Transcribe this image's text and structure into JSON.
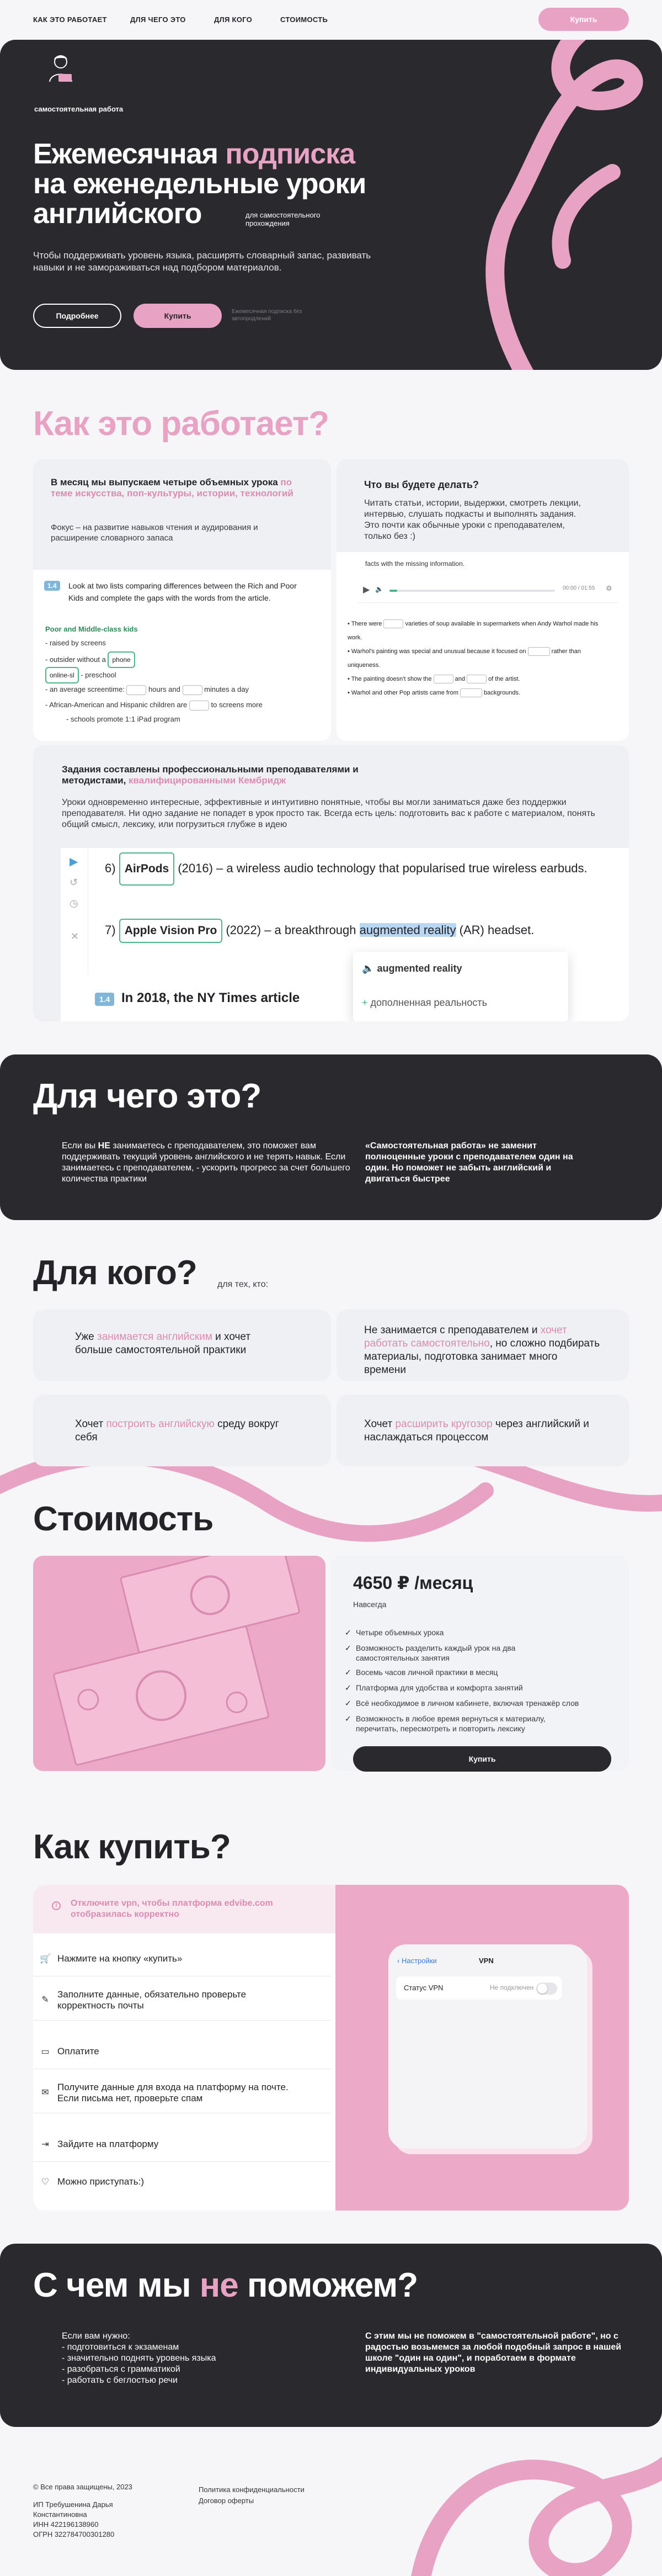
{
  "nav": {
    "links": [
      "КАК ЭТО РАБОТАЕТ",
      "ДЛЯ ЧЕГО ЭТО",
      "ДЛЯ КОГО",
      "СТОИМОСТЬ"
    ],
    "buy": "Купить"
  },
  "hero": {
    "brand": "самостоятельная работа",
    "title_a": "Ежемесячная ",
    "title_pink": "подписка",
    "title_b": "на еженедельные уроки",
    "title_c": "английского",
    "side": "для самостоятельного прохождения",
    "desc": "Чтобы поддерживать уровень языка, расширять словарный запас, развивать навыки и не замораживаться над подбором материалов.",
    "btn_more": "Подробнее",
    "btn_buy": "Купить",
    "note": "Ежемесячная подписка без автопродлений"
  },
  "how": {
    "title": "Как это работает?",
    "c1": {
      "title_a": "В месяц мы выпускаем четыре объемных урока ",
      "title_pink": "по теме искусства, поп-культуры, истории, технологий",
      "sub": "Фокус – на развитие навыков чтения и аудирования и расширение словарного запаса",
      "task_no": "1.4",
      "task": "Look at two lists comparing differences between the Rich and Poor Kids and complete the gaps with the words from the article.",
      "list_title": "Poor and Middle-class kids",
      "items": [
        "- raised by screens",
        "- outsider without a",
        "- preschool",
        "- an average screentime:",
        "hours and",
        "minutes a day",
        "- African-American and Hispanic children are",
        "to screens more",
        "- schools promote 1:1 iPad program"
      ],
      "chip1": "phone",
      "chip2": "online-sl"
    },
    "c2": {
      "title": "Что вы будете делать?",
      "text": "Читать статьи, истории, выдержки, смотреть лекции, интервью, слушать подкасты и выполнять задания. Это почти как обычные уроки с преподавателем, только без :)",
      "facts": "facts with the missing information.",
      "time": "00:00 / 01:55",
      "b1": "• There were",
      "b1b": "varieties of soup available in supermarkets when Andy Warhol made his work.",
      "b2": "• Warhol's painting was special and unusual because it focused on",
      "b2b": "rather than uniqueness.",
      "b3": "• The painting doesn't show the",
      "b3b": "and",
      "b3c": "of the artist.",
      "b4": "• Warhol and other Pop artists came from",
      "b4b": "backgrounds."
    },
    "c3": {
      "title_a": "Задания составлены профессиональными преподавателями и методистами, ",
      "title_pink": "квалифицированными Кембридж",
      "text": "Уроки одновременно интересные, эффективные и интуитивно понятные, чтобы вы могли заниматься даже без поддержки преподавателя. Ни одно задание не попадет в урок просто так. Всегда есть цель: подготовить вас к работе с материалом, понять общий смысл, лексику, или погрузиться глубже в идею",
      "l1n": "6)",
      "l1chip": "AirPods",
      "l1": "(2016) – a wireless audio technology that popularised true wireless earbuds.",
      "l2n": "7)",
      "l2chip": "Apple Vision Pro",
      "l2a": "(2022) – a breakthrough ",
      "l2hl": "augmented reality",
      "l2b": " (AR) headset.",
      "pop1": "augmented reality",
      "pop2": "дополненная реальность",
      "t3no": "1.4",
      "t3": "In 2018, the NY Times article"
    }
  },
  "why": {
    "title": "Для чего это?",
    "left_a": "Если вы ",
    "left_b": "НЕ",
    "left_c": " занимаетесь с преподавателем, это поможет вам поддерживать текущий уровень английского и не терять навык. Если занимаетесь с преподавателем, - ускорить прогресс за счет большего количества практики",
    "right": "«Самостоятельная работа» не заменит полноценные уроки с преподавателем один на один. Но поможет не забыть английский и двигаться быстрее"
  },
  "who": {
    "title": "Для кого?",
    "sub": "для тех, кто:",
    "c1a": "Уже ",
    "c1p": "занимается английским",
    "c1b": " и хочет больше самостоятельной практики",
    "c2a": "Не занимается с преподавателем и ",
    "c2p": "хочет работать самостоятельно",
    "c2b": ", но сложно подбирать материалы, подготовка занимает много времени",
    "c3a": "Хочет ",
    "c3p": "построить английскую",
    "c3b": " среду вокруг себя",
    "c4a": "Хочет ",
    "c4p": "расширить кругозор",
    "c4b": " через английский и наслаждаться процессом"
  },
  "price": {
    "title": "Стоимость",
    "amount": "4650 ₽ /месяц",
    "period": "Навсегда",
    "features": [
      "Четыре объемных урока",
      "Возможность разделить каждый урок на два самостоятельных занятия",
      "Восемь часов личной практики в месяц",
      "Платформа для удобства и комфорта занятий",
      "Всё необходимое в личном кабинете, включая тренажёр слов",
      "Возможность в любое время вернуться к материалу, перечитать, пересмотреть и повторить лексику"
    ],
    "buy": "Купить"
  },
  "howbuy": {
    "title": "Как купить?",
    "warn": "Отключите vpn, чтобы платформа edvibe.com отобразилась корректно",
    "steps": [
      "Нажмите на кнопку «купить»",
      "Заполните данные, обязательно проверьте корректность почты",
      "Оплатите",
      "Получите данные для входа на платформу на почте. Если письма нет, проверьте спам",
      "Зайдите на платформу",
      "Можно приступать:)"
    ],
    "phone_back": "Настройки",
    "phone_title": "VPN",
    "phone_row": "Статус VPN",
    "phone_status": "Не подключен"
  },
  "help": {
    "title_a": "С чем мы ",
    "title_pink": "не",
    "title_b": " поможем?",
    "left_intro": "Если вам нужно:",
    "left_items": [
      "- подготовиться к экзаменам",
      "- значительно поднять уровень языка",
      "- разобраться с грамматикой",
      "- работать с беглостью речи"
    ],
    "right": "С этим мы не поможем в \"самостоятельной работе\", но с радостью возьмемся за любой подобный запрос в нашей школе \"один на один\", и поработаем в формате индивидуальных уроков"
  },
  "footer": {
    "copy": "© Все права защищены, 2023",
    "owner": "ИП Требушенина Дарья Константиновна",
    "inn": "ИНН 422196138960",
    "ogrn": "ОГРН 322784700301280",
    "policy": "Политика конфиденциальности",
    "offer": "Договор оферты"
  },
  "colors": {
    "pink": "#e8a3c4",
    "dark": "#29292e",
    "green": "#4cb58a"
  }
}
